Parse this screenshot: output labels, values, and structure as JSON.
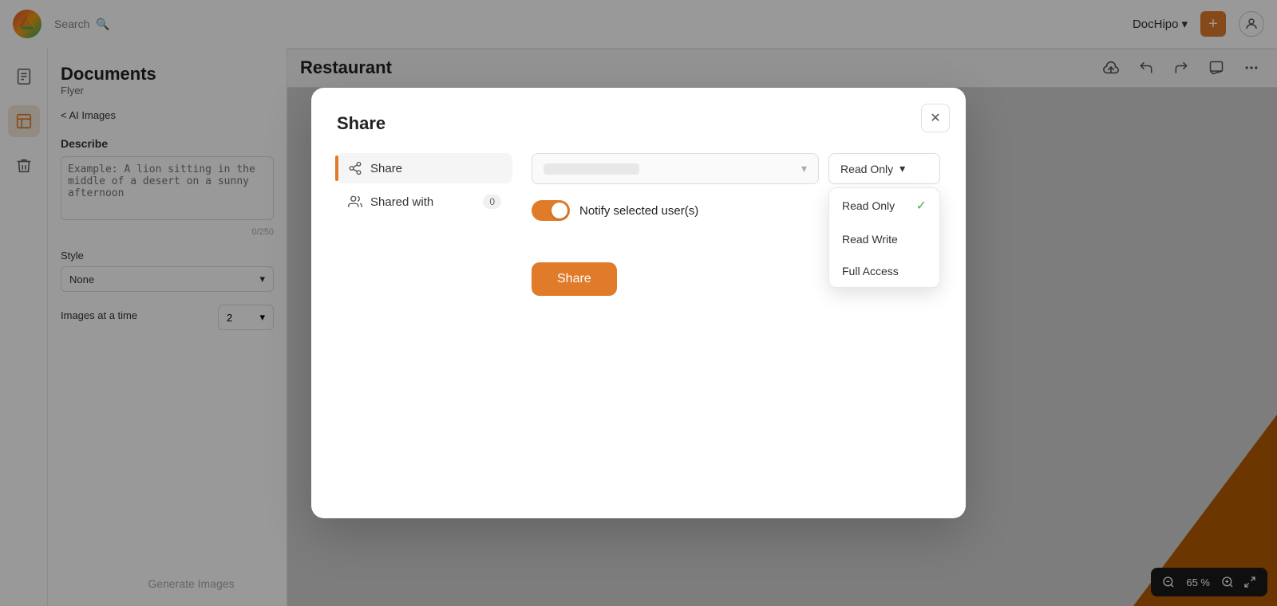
{
  "topbar": {
    "search_placeholder": "Search",
    "brand_name": "DocHipo",
    "add_btn_label": "+",
    "chevron": "▾"
  },
  "sidebar": {
    "items": [
      {
        "label": "📄",
        "active": false
      },
      {
        "label": "📝",
        "active": true
      },
      {
        "label": "🗑",
        "active": false
      }
    ]
  },
  "left_panel": {
    "title": "Documents",
    "subtitle": "Flyer",
    "back_label": "< AI Images",
    "describe_label": "Describe",
    "describe_placeholder": "Example: A lion sitting in the middle of a desert on a sunny afternoon",
    "describe_counter": "0/250",
    "style_label": "Style",
    "style_value": "None",
    "images_at_time_label": "Images at a time",
    "images_at_time_value": "2",
    "generate_label": "Generate Images"
  },
  "canvas": {
    "title": "Restaurant",
    "zoom": "65 %"
  },
  "modal": {
    "title": "Share",
    "close_label": "✕",
    "sidebar_items": [
      {
        "label": "Share",
        "active": true
      },
      {
        "label": "Shared with",
        "badge": "0"
      }
    ],
    "share_input_placeholder": "",
    "permission_label": "Read Only",
    "permission_chevron": "▾",
    "dropdown_options": [
      {
        "label": "Read Only",
        "selected": true
      },
      {
        "label": "Read Write",
        "selected": false
      },
      {
        "label": "Full Access",
        "selected": false
      }
    ],
    "notify_label": "Notify selected user(s)",
    "share_btn_label": "Share"
  }
}
